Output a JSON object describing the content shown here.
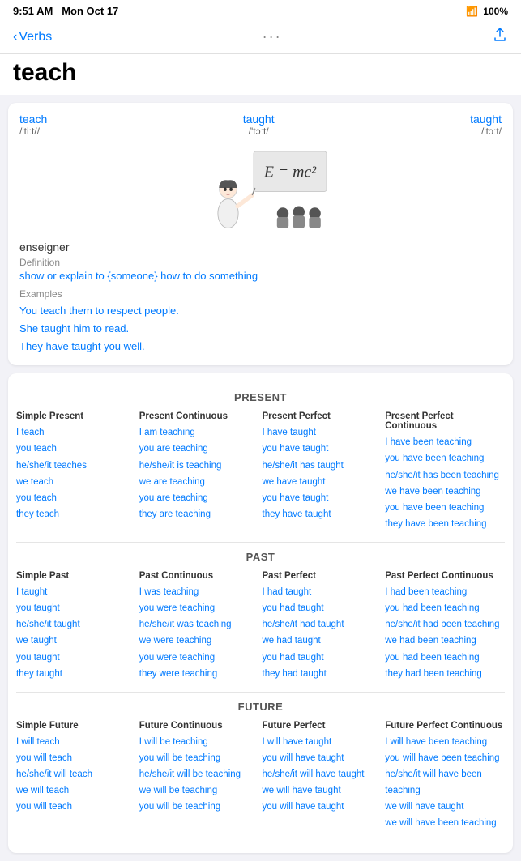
{
  "statusBar": {
    "time": "9:51 AM",
    "day": "Mon Oct 17",
    "battery": "100%"
  },
  "nav": {
    "back": "Verbs",
    "share": "↑"
  },
  "title": "teach",
  "wordCard": {
    "forms": [
      {
        "word": "teach",
        "phonetic": "/'tiːt//"
      },
      {
        "word": "taught",
        "phonetic": "/'tɔːt/"
      },
      {
        "word": "taught",
        "phonetic": "/'tɔːt/"
      }
    ],
    "nativeWord": "enseigner",
    "definitionLabel": "Definition",
    "definition": "show or explain to {someone} how to do something",
    "examplesLabel": "Examples",
    "examples": [
      "You teach them to respect people.",
      "She taught him to read.",
      "They have taught you well."
    ]
  },
  "conjugation": {
    "present": {
      "title": "PRESENT",
      "columns": [
        {
          "header": "Simple Present",
          "forms": [
            "I teach",
            "you teach",
            "he/she/it teaches",
            "we teach",
            "you teach",
            "they teach"
          ]
        },
        {
          "header": "Present Continuous",
          "forms": [
            "I am teaching",
            "you are teaching",
            "he/she/it is teaching",
            "we are teaching",
            "you are teaching",
            "they are teaching"
          ]
        },
        {
          "header": "Present Perfect",
          "forms": [
            "I have taught",
            "you have taught",
            "he/she/it has taught",
            "we have taught",
            "you have taught",
            "they have taught"
          ]
        },
        {
          "header": "Present Perfect Continuous",
          "forms": [
            "I have been teaching",
            "you have been teaching",
            "he/she/it has been teaching",
            "we have been teaching",
            "you have been teaching",
            "they have been teaching"
          ]
        }
      ]
    },
    "past": {
      "title": "PAST",
      "columns": [
        {
          "header": "Simple Past",
          "forms": [
            "I taught",
            "you taught",
            "he/she/it taught",
            "we taught",
            "you taught",
            "they taught"
          ]
        },
        {
          "header": "Past Continuous",
          "forms": [
            "I was teaching",
            "you were teaching",
            "he/she/it was teaching",
            "we were teaching",
            "you were teaching",
            "they were teaching"
          ]
        },
        {
          "header": "Past Perfect",
          "forms": [
            "I had taught",
            "you had taught",
            "he/she/it had taught",
            "we had taught",
            "you had taught",
            "they had taught"
          ]
        },
        {
          "header": "Past Perfect Continuous",
          "forms": [
            "I had been teaching",
            "you had been teaching",
            "he/she/it had been teaching",
            "we had been teaching",
            "you had been teaching",
            "they had been teaching"
          ]
        }
      ]
    },
    "future": {
      "title": "FUTURE",
      "columns": [
        {
          "header": "Simple Future",
          "forms": [
            "I will teach",
            "you will teach",
            "he/she/it will teach",
            "we will teach",
            "you will teach"
          ]
        },
        {
          "header": "Future Continuous",
          "forms": [
            "I will be teaching",
            "you will be teaching",
            "he/she/it will be teaching",
            "we will be teaching",
            "you will be teaching"
          ]
        },
        {
          "header": "Future Perfect",
          "forms": [
            "I will have taught",
            "you will have taught",
            "he/she/it will have taught",
            "we will have taught",
            "you will have taught"
          ]
        },
        {
          "header": "Future Perfect Continuous",
          "forms": [
            "I will have been teaching",
            "you will have been teaching",
            "he/she/it will have been teaching",
            "we will have taught",
            "we will have been teaching"
          ]
        }
      ]
    }
  }
}
